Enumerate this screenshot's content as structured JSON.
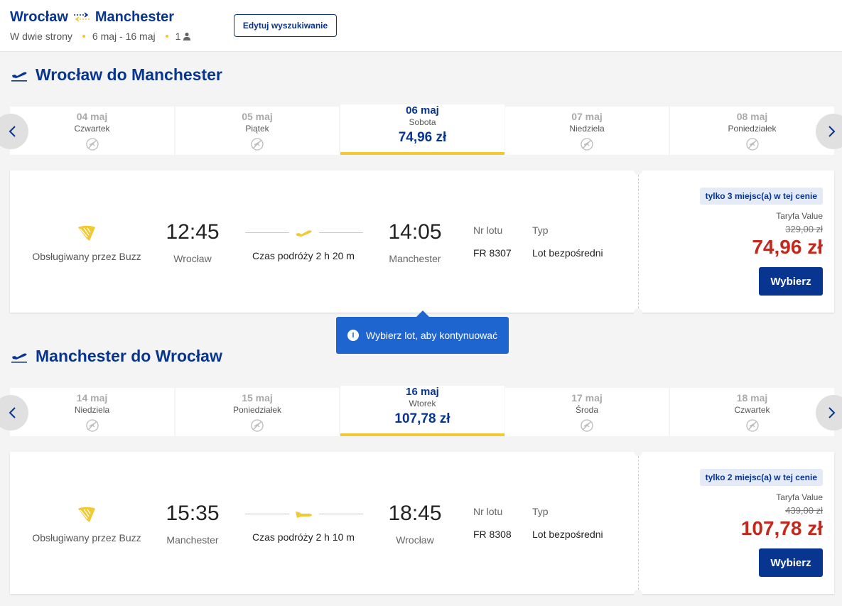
{
  "header": {
    "origin": "Wrocław",
    "destination": "Manchester",
    "trip_type": "W dwie strony",
    "dates": "6 maj - 16 maj",
    "passengers": "1",
    "edit_label": "Edytuj wyszukiwanie"
  },
  "colors": {
    "brand": "#073590",
    "accent": "#f1c933",
    "price": "#c4271b",
    "tooltip": "#1e65d0"
  },
  "outbound": {
    "title": "Wrocław do Manchester",
    "dates": [
      {
        "date": "04 maj",
        "weekday": "Czwartek"
      },
      {
        "date": "05 maj",
        "weekday": "Piątek"
      },
      {
        "date": "06 maj",
        "weekday": "Sobota",
        "price": "74,96 zł"
      },
      {
        "date": "07 maj",
        "weekday": "Niedziela"
      },
      {
        "date": "08 maj",
        "weekday": "Poniedziałek"
      }
    ],
    "flight": {
      "operator": "Obsługiwany przez Buzz",
      "dep_time": "12:45",
      "dep_city": "Wrocław",
      "arr_time": "14:05",
      "arr_city": "Manchester",
      "duration": "Czas podróży 2 h 20 m",
      "flight_no_label": "Nr lotu",
      "flight_no": "FR 8307",
      "type_label": "Typ",
      "type": "Lot bezpośredni",
      "badge": "tylko 3 miejsc(a) w tej cenie",
      "fare": "Taryfa Value",
      "old_price": "329,00 zł",
      "price": "74,96 zł",
      "select_label": "Wybierz"
    }
  },
  "tooltip": {
    "text": "Wybierz lot, aby kontynuować"
  },
  "inbound": {
    "title": "Manchester do Wrocław",
    "dates": [
      {
        "date": "14 maj",
        "weekday": "Niedziela"
      },
      {
        "date": "15 maj",
        "weekday": "Poniedziałek"
      },
      {
        "date": "16 maj",
        "weekday": "Wtorek",
        "price": "107,78 zł"
      },
      {
        "date": "17 maj",
        "weekday": "Środa"
      },
      {
        "date": "18 maj",
        "weekday": "Czwartek"
      }
    ],
    "flight": {
      "operator": "Obsługiwany przez Buzz",
      "dep_time": "15:35",
      "dep_city": "Manchester",
      "arr_time": "18:45",
      "arr_city": "Wrocław",
      "duration": "Czas podróży 2 h 10 m",
      "flight_no_label": "Nr lotu",
      "flight_no": "FR 8308",
      "type_label": "Typ",
      "type": "Lot bezpośredni",
      "badge": "tylko 2 miejsc(a) w tej cenie",
      "fare": "Taryfa Value",
      "old_price": "439,00 zł",
      "price": "107,78 zł",
      "select_label": "Wybierz"
    }
  }
}
